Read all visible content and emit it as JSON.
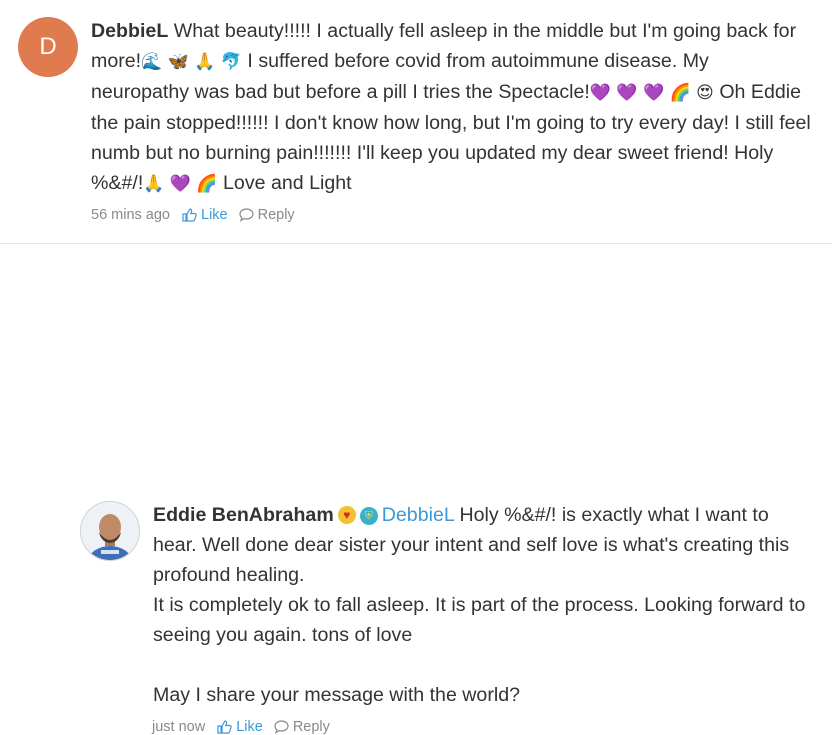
{
  "comments": [
    {
      "avatar_letter": "D",
      "author": "DebbieL",
      "text_parts": [
        " What beauty!!!!! I actually fell asleep in the middle but I'm going back for more!",
        " I suffered before covid from autoimmune disease. My neuropathy was bad but before a pill I tries the Spectacle!",
        " Oh Eddie the pain stopped!!!!!! I don't know how long, but I'm going to try every day! I still feel numb but no burning pain!!!!!!! I'll keep you updated my dear sweet friend! Holy %&#/!",
        " Love and Light"
      ],
      "emoji_groups": [
        "🌊 🦋 🙏 🐬",
        "💜 💜 💜 🌈 😍",
        "🙏 💜 🌈"
      ],
      "time": "56 mins ago",
      "like_label": "Like",
      "reply_label": "Reply"
    },
    {
      "author": "Eddie BenAbraham",
      "mention": "DebbieL",
      "badge_heart": "♥",
      "badge_shield": "⛨",
      "lines": [
        " Holy %&#/! is exactly what I want to hear. Well done dear sister your intent and self love is what's creating this profound healing.",
        "It is completely ok to fall asleep. It is part of the process. Looking forward to seeing you again. tons of love",
        "May I share your message with the world?"
      ],
      "time": "just now",
      "like_label": "Like",
      "reply_label": "Reply"
    }
  ],
  "icons": {
    "like": "thumbs-up-icon",
    "reply": "speech-bubble-icon"
  },
  "colors": {
    "link": "#3a9ad9",
    "avatar_d": "#e07a4f",
    "text": "#333333",
    "meta": "#8a8a8a"
  }
}
